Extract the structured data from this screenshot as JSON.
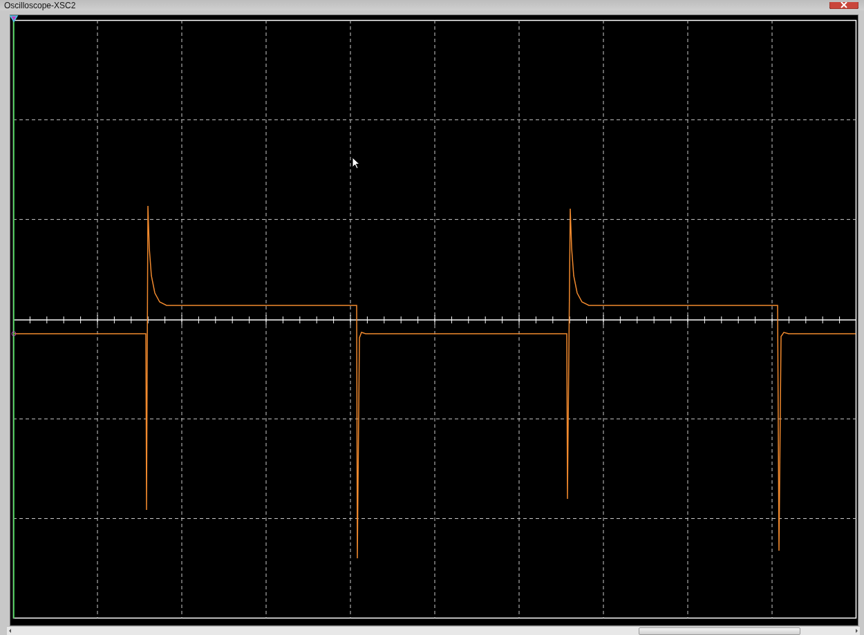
{
  "window": {
    "title": "Oscilloscope-XSC2"
  }
}
